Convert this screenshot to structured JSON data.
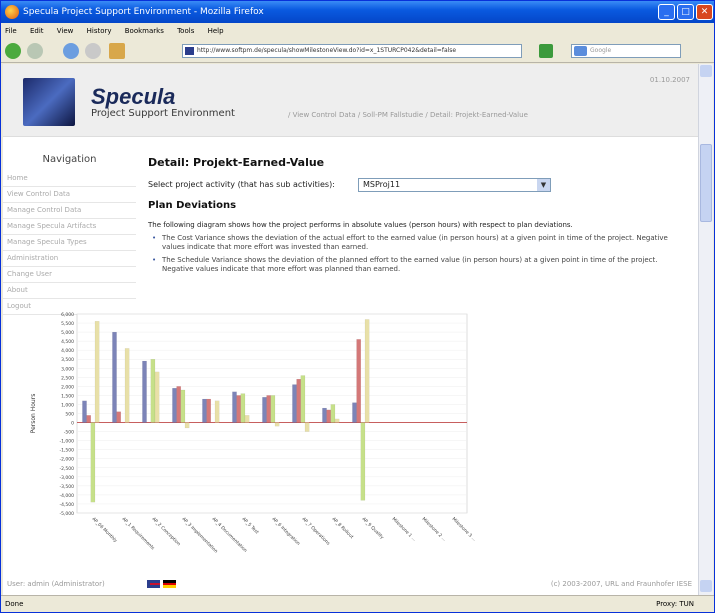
{
  "window": {
    "title": "Specula Project Support Environment - Mozilla Firefox"
  },
  "menu": [
    "File",
    "Edit",
    "View",
    "History",
    "Bookmarks",
    "Tools",
    "Help"
  ],
  "address": {
    "url": "http://www.softpm.de/specula/showMilestoneView.do?id=x_1STURCP042&detail=false"
  },
  "search": {
    "placeholder": "Google"
  },
  "header": {
    "brand": "Specula",
    "subtitle": "Project Support Environment",
    "breadcrumb": "/ View Control Data / Soll-PM Fallstudie / Detail: Projekt-Earned-Value",
    "date": "01.10.2007"
  },
  "sidebar": {
    "title": "Navigation",
    "items": [
      "Home",
      "View Control Data",
      "Manage Control Data",
      "Manage Specula Artifacts",
      "Manage Specula Types",
      "Administration",
      "Change User",
      "About",
      "Logout"
    ]
  },
  "main": {
    "title": "Detail: Projekt-Earned-Value",
    "select_label": "Select project activity (that has sub activities):",
    "select_value": "MSProj11",
    "section_title": "Plan Deviations",
    "intro": "The following diagram shows how the project performs in absolute values (person hours) with respect to plan deviations.",
    "bullets": [
      "The Cost Variance shows the deviation of the actual effort to the earned value (in person hours) at a given point in time of the project. Negative values indicate that more effort was invested than earned.",
      "The Schedule Variance shows the deviation of the planned effort to the earned value (in person hours) at a given point in time of the project. Negative values indicate that more effort was planned than earned."
    ]
  },
  "footer": {
    "user": "User: admin (Administrator)",
    "copyright": "(c) 2003-2007, URL and Fraunhofer IESE"
  },
  "statusbar": {
    "left": "Done",
    "right": "Proxy: TUN"
  },
  "colors": {
    "series1": "#7c84b8",
    "series2": "#d47878",
    "series3": "#c6e08a",
    "series4": "#e8e0a8"
  },
  "chart_data": {
    "type": "bar",
    "ylabel": "Person Hours",
    "ylim": [
      -5000,
      6000
    ],
    "yticks": [
      6000,
      5500,
      5000,
      4500,
      4000,
      3500,
      3000,
      2500,
      2000,
      1500,
      1000,
      500,
      0,
      -500,
      -1000,
      -1500,
      -2000,
      -2500,
      -3000,
      -3500,
      -4000,
      -4500,
      -5000
    ],
    "categories": [
      "AP_06 Monthly",
      "AP_1 Requirements",
      "AP_2 Conception",
      "AP_3 Implementation",
      "AP_4 Documentation",
      "AP_5 Test",
      "AP_6 Integration",
      "AP_7 Operations",
      "AP_8 Rollout",
      "AP_9 Quality",
      "Milestone 1 ...",
      "Milestone 2 ...",
      "Milestone 3 ..."
    ],
    "series": [
      {
        "values": [
          1200,
          5000,
          3400,
          1900,
          1300,
          1700,
          1400,
          2100,
          800,
          1100,
          0,
          0,
          0
        ]
      },
      {
        "values": [
          400,
          600,
          0,
          2000,
          1300,
          1500,
          1500,
          2400,
          700,
          4600,
          0,
          0,
          0
        ]
      },
      {
        "values": [
          -4400,
          0,
          3500,
          1800,
          0,
          1600,
          1500,
          2600,
          1000,
          -4300,
          0,
          0,
          0
        ]
      },
      {
        "values": [
          5600,
          4100,
          2800,
          -300,
          1200,
          400,
          -200,
          -500,
          200,
          5700,
          0,
          0,
          0
        ]
      }
    ]
  }
}
